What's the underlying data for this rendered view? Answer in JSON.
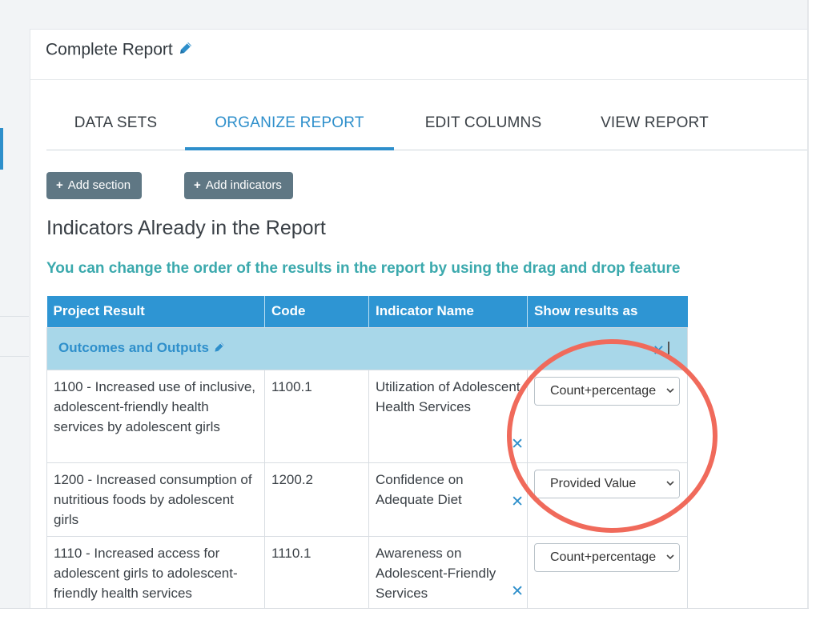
{
  "header": {
    "title": "Complete Report"
  },
  "tabs": [
    {
      "label": "DATA SETS",
      "active": false
    },
    {
      "label": "ORGANIZE REPORT",
      "active": true
    },
    {
      "label": "EDIT COLUMNS",
      "active": false
    },
    {
      "label": "VIEW REPORT",
      "active": false
    }
  ],
  "actions": {
    "add_section": "Add section",
    "add_indicators": "Add indicators"
  },
  "heading": "Indicators Already in the Report",
  "hint": "You can change the order of the results in the report by using the drag and drop feature",
  "table": {
    "columns": [
      "Project Result",
      "Code",
      "Indicator Name",
      "Show results as"
    ],
    "section": {
      "name": "Outcomes and Outputs"
    },
    "rows": [
      {
        "result": "1100 - Increased use of inclusive, adolescent-friendly health services by adolescent girls",
        "code": "1100.1",
        "indicator": "Utilization of Adolescent Health Services",
        "show_as": "Count+percentage"
      },
      {
        "result": "1200 - Increased consumption of nutritious foods by adolescent girls",
        "code": "1200.2",
        "indicator": "Confidence on Adequate Diet",
        "show_as": "Provided Value"
      },
      {
        "result": "1110 - Increased access for adolescent girls to adolescent-friendly health services",
        "code": "1110.1",
        "indicator": "Awareness on Adolescent-Friendly Services",
        "show_as": "Count+percentage"
      }
    ]
  },
  "colors": {
    "accent": "#2e8fcb",
    "header_bg": "#2e95d3",
    "section_bg": "#a8d7e9",
    "hint": "#3ba9ad",
    "button": "#5f7784",
    "highlight_circle": "#f06a5b"
  }
}
